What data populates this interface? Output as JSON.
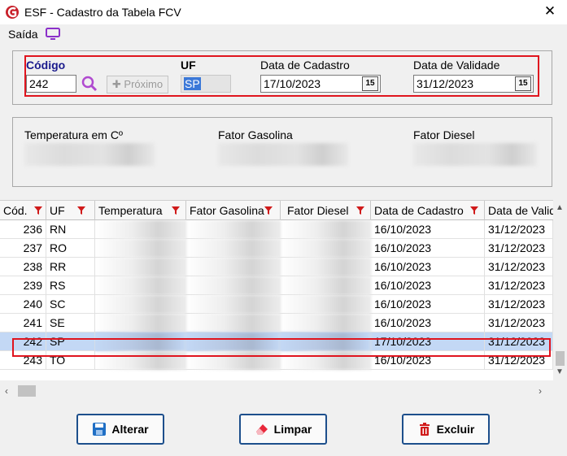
{
  "window": {
    "title": "ESF - Cadastro da Tabela FCV",
    "close_label": "✕"
  },
  "menu": {
    "saida_label": "Saída"
  },
  "form": {
    "codigo_label": "Código",
    "codigo_value": "242",
    "proximo_label": "Próximo",
    "uf_label": "UF",
    "uf_value": "SP",
    "data_cadastro_label": "Data de Cadastro",
    "data_cadastro_value": "17/10/2023",
    "data_validade_label": "Data de Validade",
    "data_validade_value": "31/12/2023",
    "calendar_label": "15",
    "temperatura_label": "Temperatura em Cº",
    "fator_gasolina_label": "Fator Gasolina",
    "fator_diesel_label": "Fator Diesel"
  },
  "grid": {
    "headers": [
      "Cód.",
      "UF",
      "Temperatura",
      "Fator Gasolina",
      "Fator Diesel",
      "Data de Cadastro",
      "Data de Valid"
    ],
    "rows": [
      {
        "cod": "236",
        "uf": "RN",
        "cad": "16/10/2023",
        "val": "31/12/2023"
      },
      {
        "cod": "237",
        "uf": "RO",
        "cad": "16/10/2023",
        "val": "31/12/2023"
      },
      {
        "cod": "238",
        "uf": "RR",
        "cad": "16/10/2023",
        "val": "31/12/2023"
      },
      {
        "cod": "239",
        "uf": "RS",
        "cad": "16/10/2023",
        "val": "31/12/2023"
      },
      {
        "cod": "240",
        "uf": "SC",
        "cad": "16/10/2023",
        "val": "31/12/2023"
      },
      {
        "cod": "241",
        "uf": "SE",
        "cad": "16/10/2023",
        "val": "31/12/2023"
      },
      {
        "cod": "242",
        "uf": "SP",
        "cad": "17/10/2023",
        "val": "31/12/2023",
        "selected": true
      },
      {
        "cod": "243",
        "uf": "TO",
        "cad": "16/10/2023",
        "val": "31/12/2023"
      }
    ]
  },
  "buttons": {
    "alterar": "Alterar",
    "limpar": "Limpar",
    "excluir": "Excluir"
  },
  "colors": {
    "highlight": "#e0141e",
    "selection": "#c3d8f5",
    "accent_blue": "#1d4f8c"
  }
}
